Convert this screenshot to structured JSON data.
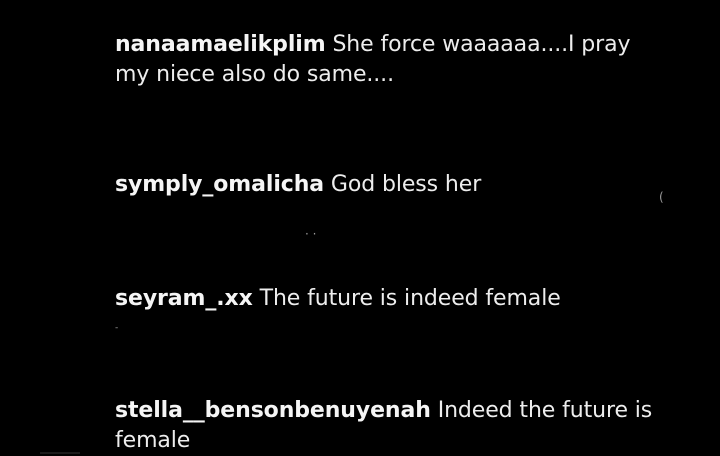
{
  "comments": [
    {
      "username": "nanaamaelikplim",
      "text": "She force waaaaaa....I pray my niece also do same...."
    },
    {
      "username": "symply_omalicha",
      "text": "God bless her"
    },
    {
      "username": "seyram_.xx",
      "text": "The future is indeed female"
    },
    {
      "username": "stella__bensonbenuyenah",
      "text": "Indeed the future is female"
    }
  ],
  "colors": {
    "background": "#000000",
    "username": "#f5f5f5",
    "text": "#ededed"
  }
}
